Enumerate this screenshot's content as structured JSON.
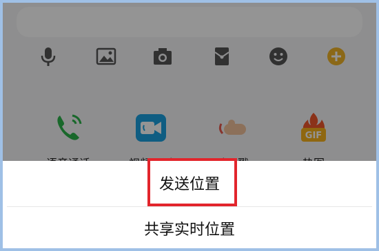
{
  "toolbar": {
    "icons": [
      "microphone-icon",
      "image-icon",
      "camera-icon",
      "red-envelope-icon",
      "emoji-icon",
      "plus-icon"
    ]
  },
  "apps": [
    {
      "label": "语音通话",
      "icon": "phone-icon"
    },
    {
      "label": "视频通话",
      "icon": "video-camera-icon"
    },
    {
      "label": "戳一戳",
      "icon": "poke-hand-icon"
    },
    {
      "label": "热图",
      "icon": "gif-icon"
    }
  ],
  "sheet": {
    "send_location": "发送位置",
    "share_live_location": "共享实时位置"
  },
  "colors": {
    "highlight": "#e2252c",
    "frame": "#9fc0e6",
    "phone_green": "#2bb34a",
    "video_blue": "#1aa1e0",
    "plus_gold": "#f0b429"
  }
}
